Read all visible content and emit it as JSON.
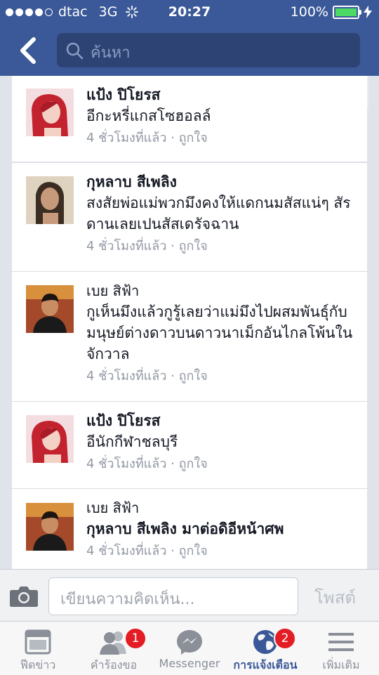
{
  "status_bar": {
    "carrier": "dtac",
    "network": "3G",
    "time": "20:27",
    "battery": "100%",
    "battery_color": "#4cd964"
  },
  "nav": {
    "back_icon": "chevron-left-icon",
    "search_placeholder": "ค้นหา"
  },
  "comments": [
    {
      "author": "แป้ง ปิโยรส",
      "author_style": "bold",
      "text": "อีกะหรี่แกสโซฮอลล์",
      "time": "4 ชั่วโมงที่แล้ว",
      "like": "ถูกใจ"
    },
    {
      "author": "กุหลาบ สีเพลิง",
      "author_style": "bold",
      "text": "สงสัยพ่อแม่พวกมึงคงให้แดกนมสัสแน่ๆ สัรดานเลยเปนสัสเดรัจฉาน",
      "time": "4 ชั่วโมงที่แล้ว",
      "like": "ถูกใจ"
    },
    {
      "author": "เบย สิฟ้า",
      "author_style": "light",
      "text": "กูเห็นมึงแล้วกูรู้เลยว่าแม่มึงไปผสมพันธุ์กับมนุษย์ต่างดาวบนดาวนาเม็กอันไกลโพ้นในจักวาล",
      "time": "4 ชั่วโมงที่แล้ว",
      "like": "ถูกใจ"
    },
    {
      "author": "แป้ง ปิโยรส",
      "author_style": "bold",
      "text": "อีนักกีฬาชลบุรี",
      "time": "4 ชั่วโมงที่แล้ว",
      "like": "ถูกใจ"
    },
    {
      "author": "เบย สิฟ้า",
      "author_style": "light",
      "text": "กุหลาบ สีเพลิง มาต่อดิอีหน้าศพ",
      "time": "4 ชั่วโมงที่แล้ว",
      "like": "ถูกใจ"
    }
  ],
  "separator": " · ",
  "comment_bar": {
    "placeholder": "เขียนความคิดเห็น...",
    "post_label": "โพสต์",
    "camera_icon": "camera-icon"
  },
  "tabs": [
    {
      "label": "ฟีดข่าว",
      "icon": "news-feed-icon",
      "badge": null,
      "active": false
    },
    {
      "label": "คำร้องขอ",
      "icon": "friend-requests-icon",
      "badge": "1",
      "active": false
    },
    {
      "label": "Messenger",
      "icon": "messenger-icon",
      "badge": null,
      "active": false
    },
    {
      "label": "การแจ้งเตือน",
      "icon": "notifications-globe-icon",
      "badge": "2",
      "active": true
    },
    {
      "label": "เพิ่มเติม",
      "icon": "menu-icon",
      "badge": null,
      "active": false
    }
  ],
  "colors": {
    "brand": "#3b5998",
    "badge": "#e41c23",
    "meta_text": "#9197a3"
  }
}
